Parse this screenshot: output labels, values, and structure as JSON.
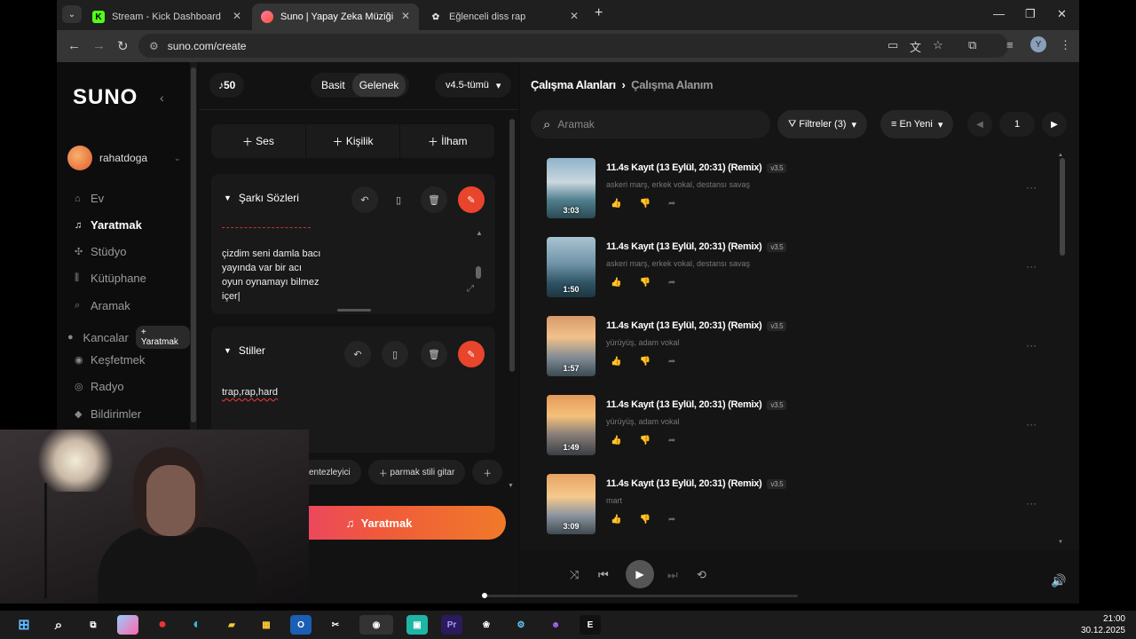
{
  "browser": {
    "tabs": [
      {
        "title": "Stream - Kick Dashboard",
        "icon": "kick-icon"
      },
      {
        "title": "Suno | Yapay Zeka Müziği",
        "icon": "suno-icon",
        "active": true
      },
      {
        "title": "Eğlenceli diss rap",
        "icon": "chatgpt-icon"
      }
    ],
    "url": "suno.com/create",
    "profile_initial": "Y"
  },
  "sidebar": {
    "logo": "SUNO",
    "username": "rahatdoga",
    "items": [
      {
        "label": "Ev",
        "icon": "home-icon"
      },
      {
        "label": "Yaratmak",
        "icon": "music-note-icon",
        "active": true
      },
      {
        "label": "Stüdyo",
        "icon": "studio-icon"
      },
      {
        "label": "Kütüphane",
        "icon": "library-icon"
      },
      {
        "label": "Aramak",
        "icon": "search-icon"
      },
      {
        "label": "Kancalar",
        "icon": "hooks-icon",
        "badge": "+ Yaratmak"
      },
      {
        "label": "Keşfetmek",
        "icon": "explore-icon"
      },
      {
        "label": "Radyo",
        "icon": "radio-icon"
      },
      {
        "label": "Bildirimler",
        "icon": "bell-icon"
      }
    ]
  },
  "create": {
    "credits": "50",
    "mode_simple": "Basit",
    "mode_custom": "Gelenek",
    "version": "v4.5-tümü",
    "add_audio": "Ses",
    "add_persona": "Kişilik",
    "add_inspiration": "İlham",
    "lyrics": {
      "title": "Şarkı Sözleri",
      "text": "çizdim seni damla bacı\nyayında var bir acı\noyun oynamayı bilmez\niçer|"
    },
    "styles": {
      "title": "Stiller",
      "text": "trap,rap,hard"
    },
    "tags": [
      "entezleyici",
      "parmak stili gitar"
    ],
    "create_button": "Yaratmak"
  },
  "workspace": {
    "breadcrumb_root": "Çalışma Alanları",
    "breadcrumb_current": "Çalışma Alanım",
    "search_placeholder": "Aramak",
    "filters_label": "Filtreler",
    "filters_count": "(3)",
    "sort_label": "En Yeni",
    "page": "1",
    "songs": [
      {
        "title": "11.4s Kayıt (13 Eylül, 20:31) (Remix)",
        "version": "v3.5",
        "tags": "askeri marş, erkek vokal, destansı savaş",
        "duration": "3:03"
      },
      {
        "title": "11.4s Kayıt (13 Eylül, 20:31) (Remix)",
        "version": "v3.5",
        "tags": "askeri marş, erkek vokal, destansı savaş",
        "duration": "1:50"
      },
      {
        "title": "11.4s Kayıt (13 Eylül, 20:31) (Remix)",
        "version": "v3.5",
        "tags": "yürüyüş, adam vokal",
        "duration": "1:57"
      },
      {
        "title": "11.4s Kayıt (13 Eylül, 20:31) (Remix)",
        "version": "v3.5",
        "tags": "yürüyüş, adam vokal",
        "duration": "1:49"
      },
      {
        "title": "11.4s Kayıt (13 Eylül, 20:31) (Remix)",
        "version": "v3.5",
        "tags": "mart",
        "duration": "3:09"
      }
    ]
  },
  "clock": {
    "time": "21:00",
    "date": "30.12.2025"
  }
}
